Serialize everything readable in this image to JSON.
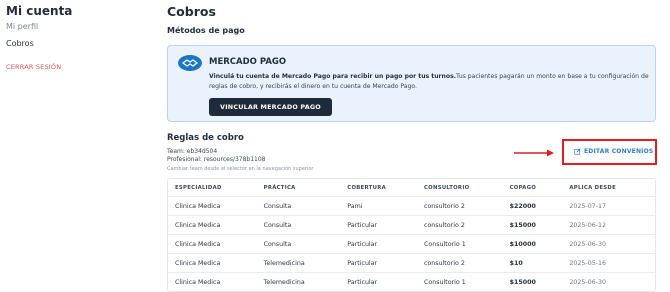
{
  "sidebar": {
    "title": "Mi cuenta",
    "items": [
      {
        "label": "Mi perfil"
      },
      {
        "label": "Cobros"
      }
    ],
    "logout_label": "CERRAR SESIÓN"
  },
  "main": {
    "page_title": "Cobros",
    "payment_methods_title": "Métodos de pago",
    "mercado_pago": {
      "title": "MERCADO PAGO",
      "description_bold": "Vinculá tu cuenta de Mercado Pago para recibir un pago por tus turnos.",
      "description_rest": "Tus pacientes pagarán un monto en base a tu configuración de reglas de cobro, y recibirás el dinero en tu cuenta de Mercado Pago.",
      "button_label": "VINCULAR MERCADO PAGO"
    },
    "rules": {
      "title": "Reglas de cobro",
      "team": "Team: eb34d504",
      "professional": "Profesional: resources/378b1108",
      "hint": "Cambiar team desde el selector en la navegación superior",
      "edit_label": "EDITAR CONVENIOS",
      "columns": [
        "ESPECIALIDAD",
        "PRÁCTICA",
        "COBERTURA",
        "CONSULTORIO",
        "COPAGO",
        "APLICA DESDE"
      ],
      "rows": [
        [
          "Clinica Medica",
          "Consulta",
          "Pami",
          "consultorio 2",
          "$22000",
          "2025-07-17"
        ],
        [
          "Clinica Medica",
          "Consulta",
          "Particular",
          "consultorio 2",
          "$15000",
          "2025-06-12"
        ],
        [
          "Clinica Medica",
          "Consulta",
          "Particular",
          "Consultorio 1",
          "$10000",
          "2025-06-30"
        ],
        [
          "Clinica Medica",
          "Telemedicina",
          "Particular",
          "consultorio 2",
          "$10",
          "2025-05-16"
        ],
        [
          "Clinica Medica",
          "Telemedicina",
          "Particular",
          "Consultorio 1",
          "$15000",
          "2025-06-30"
        ]
      ]
    }
  },
  "colors": {
    "accent": "#2a7fd4",
    "dark_button": "#1d2b3a",
    "logout": "#d9534f",
    "highlight_box": "#e11d1d",
    "card_bg": "#eaf3fd"
  }
}
